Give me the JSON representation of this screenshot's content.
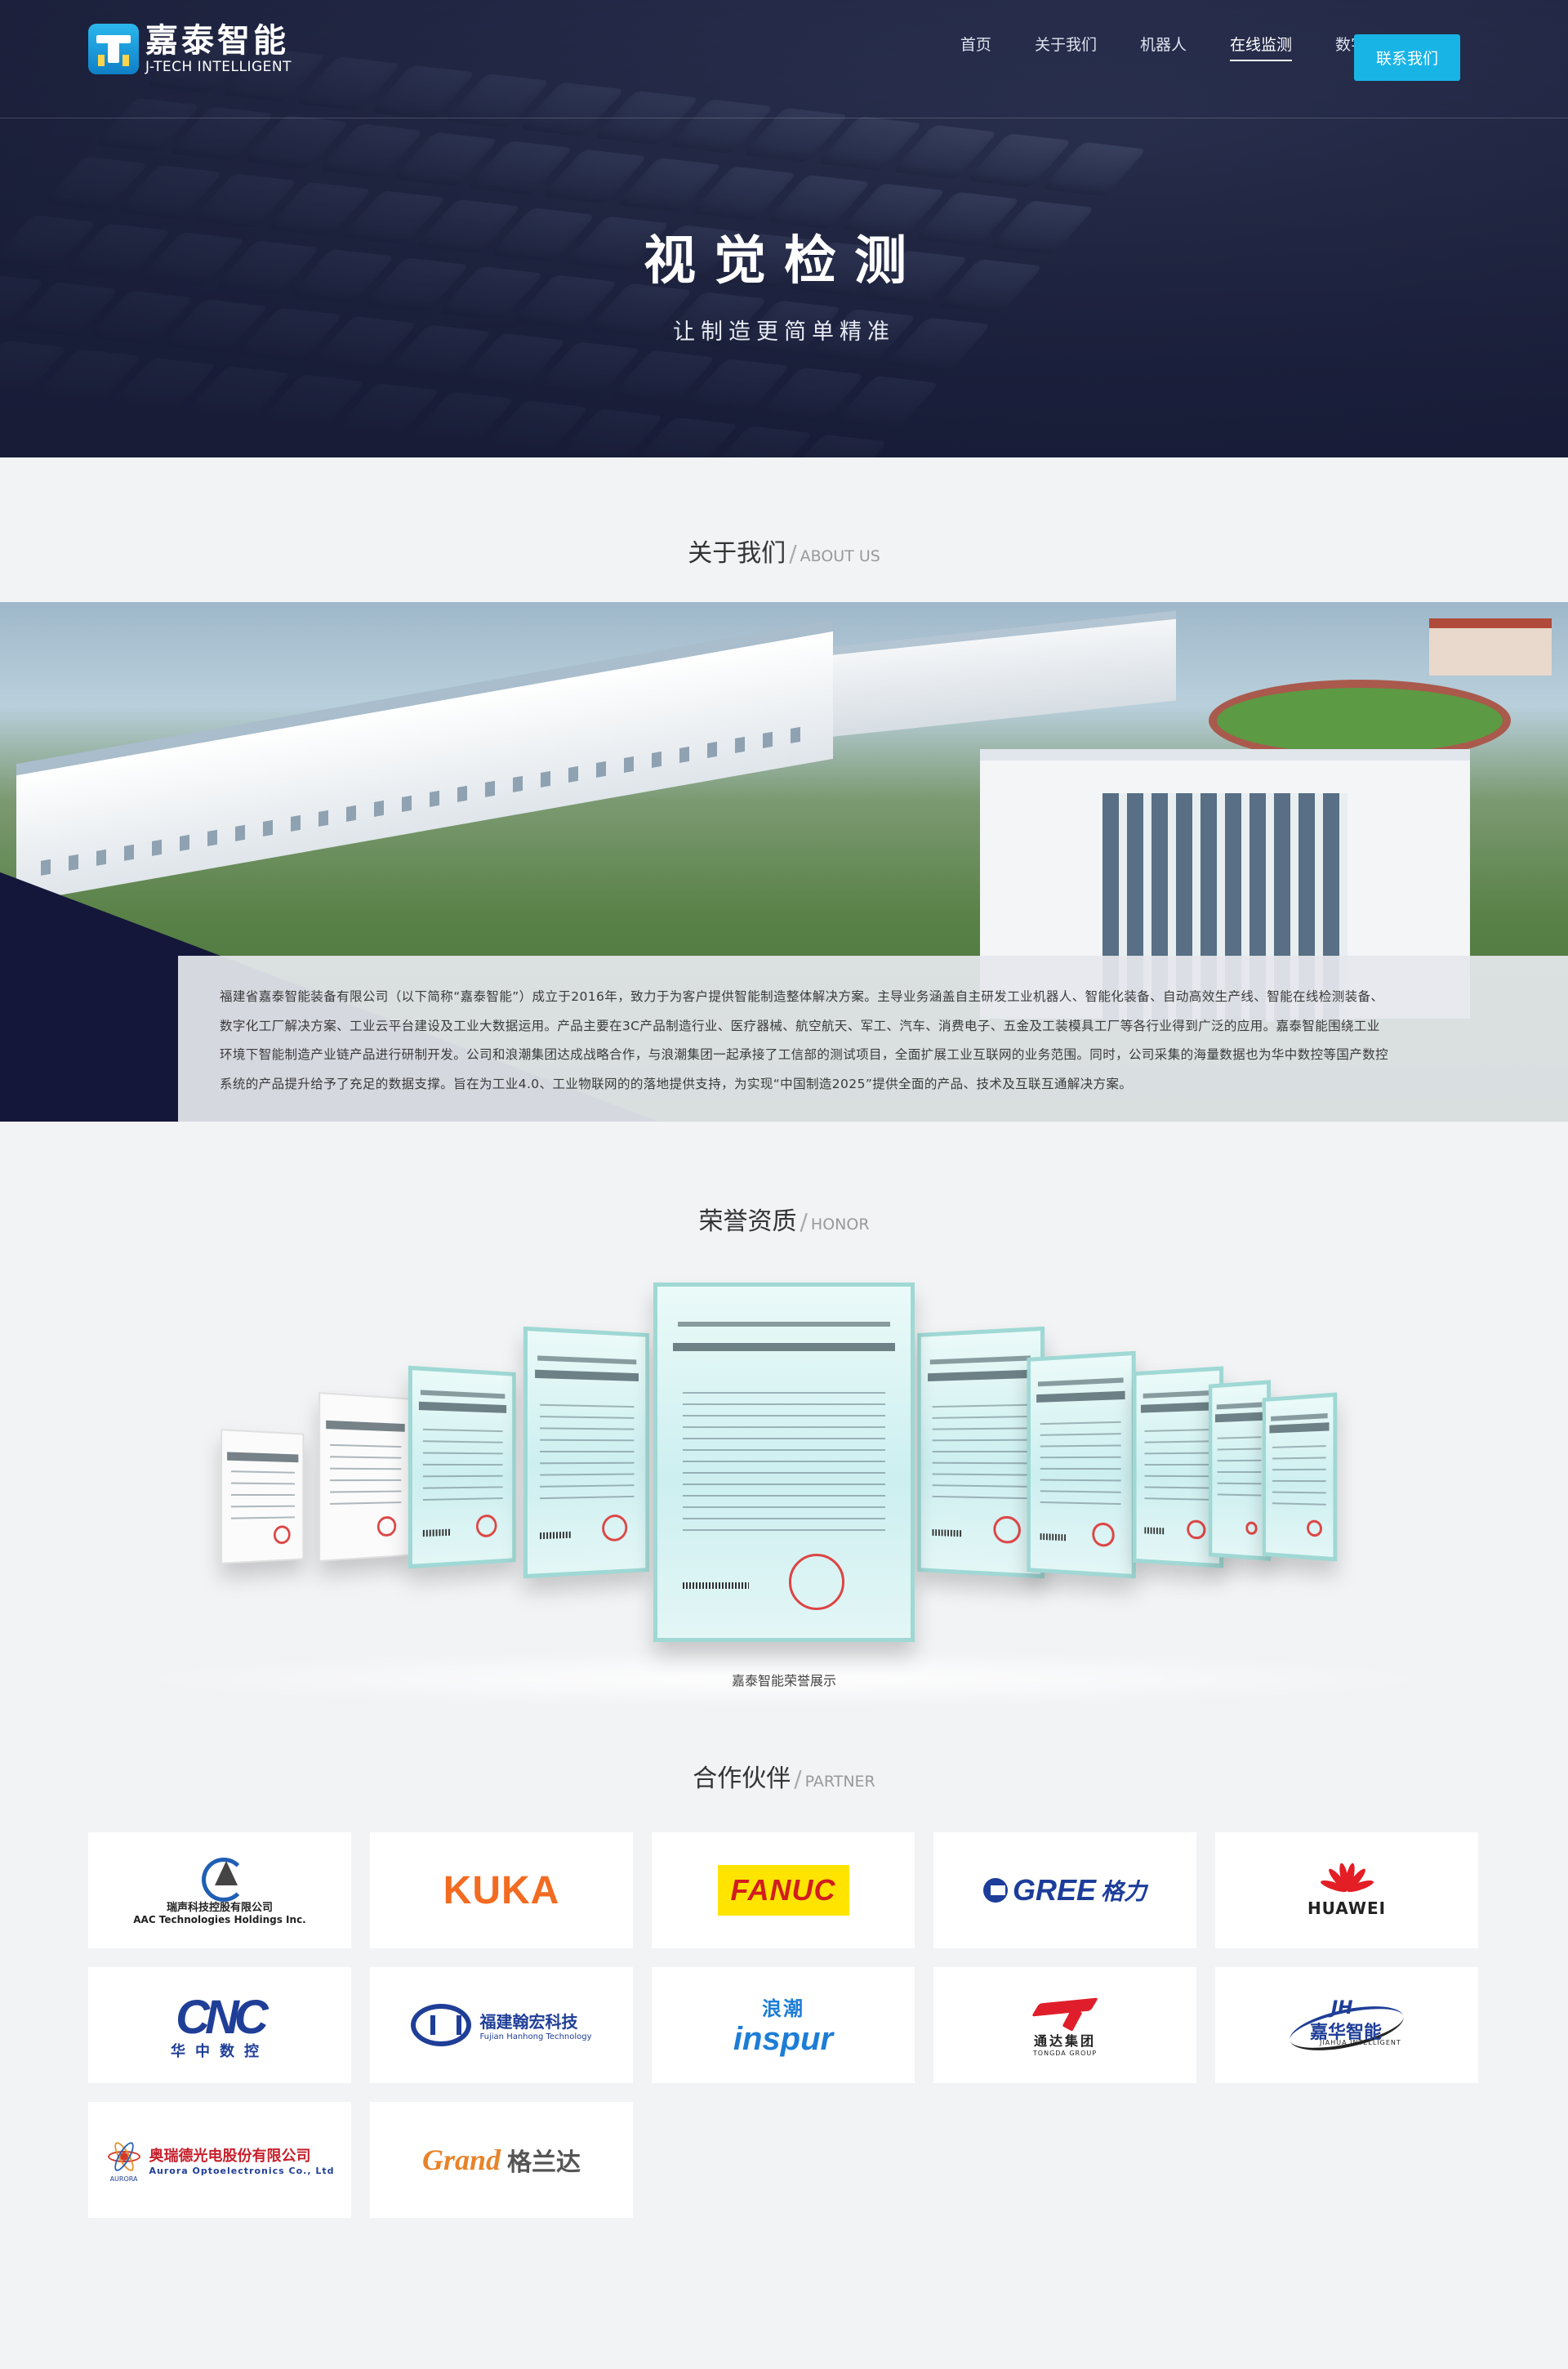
{
  "header": {
    "logo_cn": "嘉泰智能",
    "logo_en": "J-TECH INTELLIGENT",
    "nav": [
      {
        "label": "首页",
        "active": false
      },
      {
        "label": "关于我们",
        "active": false
      },
      {
        "label": "机器人",
        "active": false
      },
      {
        "label": "在线监测",
        "active": true
      },
      {
        "label": "数字化工厂",
        "active": false
      }
    ],
    "contact_label": "联系我们"
  },
  "hero": {
    "title": "视觉检测",
    "subtitle": "让制造更简单精准"
  },
  "about": {
    "heading_cn": "关于我们",
    "heading_en": "ABOUT US",
    "text": "福建省嘉泰智能装备有限公司（以下简称“嘉泰智能”）成立于2016年，致力于为客户提供智能制造整体解决方案。主导业务涵盖自主研发工业机器人、智能化装备、自动高效生产线、智能在线检测装备、数字化工厂解决方案、工业云平台建设及工业大数据运用。产品主要在3C产品制造行业、医疗器械、航空航天、军工、汽车、消费电子、五金及工装模具工厂等各行业得到广泛的应用。嘉泰智能围绕工业环境下智能制造产业链产品进行研制开发。公司和浪潮集团达成战略合作，与浪潮集团一起承接了工信部的测试项目，全面扩展工业互联网的业务范围。同时，公司采集的海量数据也为华中数控等国产数控系统的产品提升给予了充足的数据支撑。旨在为工业4.0、工业物联网的的落地提供支持，为实现“中国制造2025”提供全面的产品、技术及互联互通解决方案。"
  },
  "honor": {
    "heading_cn": "荣誉资质",
    "heading_en": "HONOR",
    "caption": "嘉泰智能荣誉展示"
  },
  "partner": {
    "heading_cn": "合作伙伴",
    "heading_en": "PARTNER",
    "logos": {
      "aac_cn": "瑞声科技控股有限公司",
      "aac_en": "AAC Technologies Holdings Inc.",
      "kuka": "KUKA",
      "fanuc": "FANUC",
      "gree_en": "GREE",
      "gree_cn": "格力",
      "huawei": "HUAWEI",
      "cnc_mark": "CNC",
      "cnc_cn": "华中数控",
      "fjhh_cn": "福建翰宏科技",
      "fjhh_en": "Fujian Hanhong Technology",
      "inspur_cn": "浪潮",
      "inspur_en": "inspur",
      "tongda_cn": "通达集团",
      "tongda_en": "TONGDA GROUP",
      "jh_tag": "JH",
      "jh_cn": "嘉华智能",
      "jh_en": "JIAHUA INTELLIGENT",
      "aurora_cn": "奥瑞德光电股份有限公司",
      "aurora_en": "Aurora Optoelectronics Co., Ltd",
      "aurora_small": "AURORA",
      "grand_en": "Grand",
      "grand_cn": "格兰达"
    }
  }
}
